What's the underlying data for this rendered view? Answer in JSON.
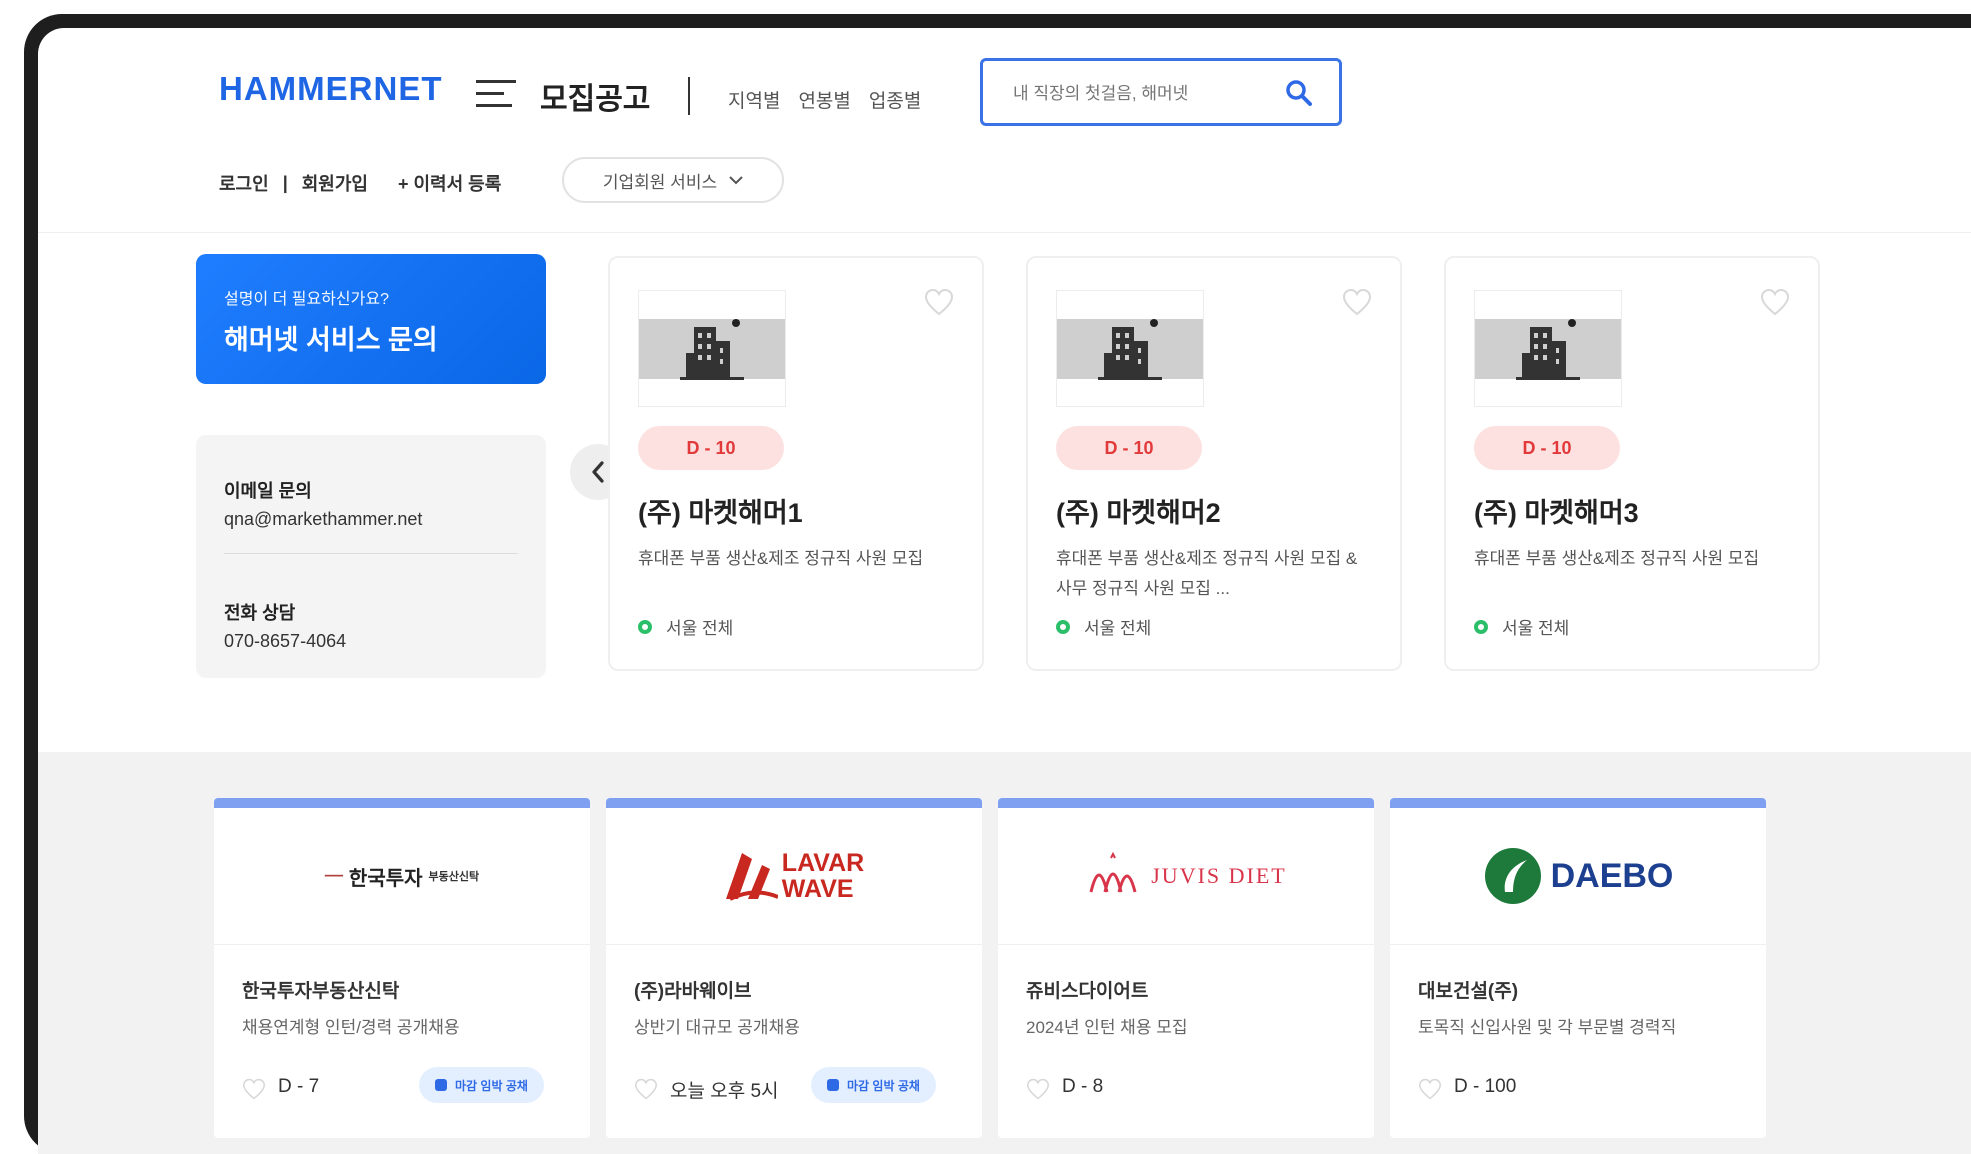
{
  "header": {
    "logo": "HAMMERNET",
    "page_title": "모집공고",
    "nav": [
      "지역별",
      "연봉별",
      "업종별"
    ],
    "search_placeholder": "내 직장의 첫걸음, 해머넷"
  },
  "auth": {
    "login": "로그인",
    "separator": "|",
    "signup": "회원가입",
    "resume": "+ 이력서 등록",
    "biz_service": "기업회원 서비스"
  },
  "promo": {
    "small": "설명이 더 필요하신가요?",
    "big": "해머넷 서비스 문의"
  },
  "contact": {
    "email_label": "이메일 문의",
    "email": "qna@markethammer.net",
    "phone_label": "전화 상담",
    "phone": "070-8657-4064"
  },
  "jobs": [
    {
      "dday": "D - 10",
      "company": "(주) 마켓해머1",
      "desc": "휴대폰 부품 생산&제조 정규직 사원 모집",
      "location": "서울 전체"
    },
    {
      "dday": "D - 10",
      "company": "(주) 마켓해머2",
      "desc": "휴대폰 부품 생산&제조 정규직 사원 모집 & 사무 정규직 사원 모집 ...",
      "location": "서울 전체"
    },
    {
      "dday": "D - 10",
      "company": "(주) 마켓해머3",
      "desc": "휴대폰 부품 생산&제조 정규직 사원 모집",
      "location": "서울 전체"
    }
  ],
  "featured": [
    {
      "logo_text": "한국투자",
      "logo_sub": "부동산신탁",
      "company": "한국투자부동산신탁",
      "desc": "채용연계형 인턴/경력 공개채용",
      "deadline": "D - 7",
      "tag": "마감 임박 공채"
    },
    {
      "logo_text": "LAVAR",
      "logo_sub": "WAVE",
      "company": "(주)라바웨이브",
      "desc": "상반기 대규모 공개채용",
      "deadline": "오늘 오후 5시",
      "tag": "마감 임박 공채"
    },
    {
      "logo_text": "JUVIS DIET",
      "logo_sub": "",
      "company": "쥬비스다이어트",
      "desc": "2024년 인턴 채용 모집",
      "deadline": "D - 8",
      "tag": ""
    },
    {
      "logo_text": "DAEBO",
      "logo_sub": "",
      "company": "대보건설(주)",
      "desc": "토목직 신입사원 및 각 부문별 경력직",
      "deadline": "D - 100",
      "tag": ""
    }
  ],
  "colors": {
    "brand": "#1f66e5",
    "promo": "#1f7dff",
    "dday_bg": "#fde0e0",
    "dday_text": "#e23a3a",
    "location_pin": "#2bbf6a",
    "featured_border": "#7f9ff0"
  }
}
